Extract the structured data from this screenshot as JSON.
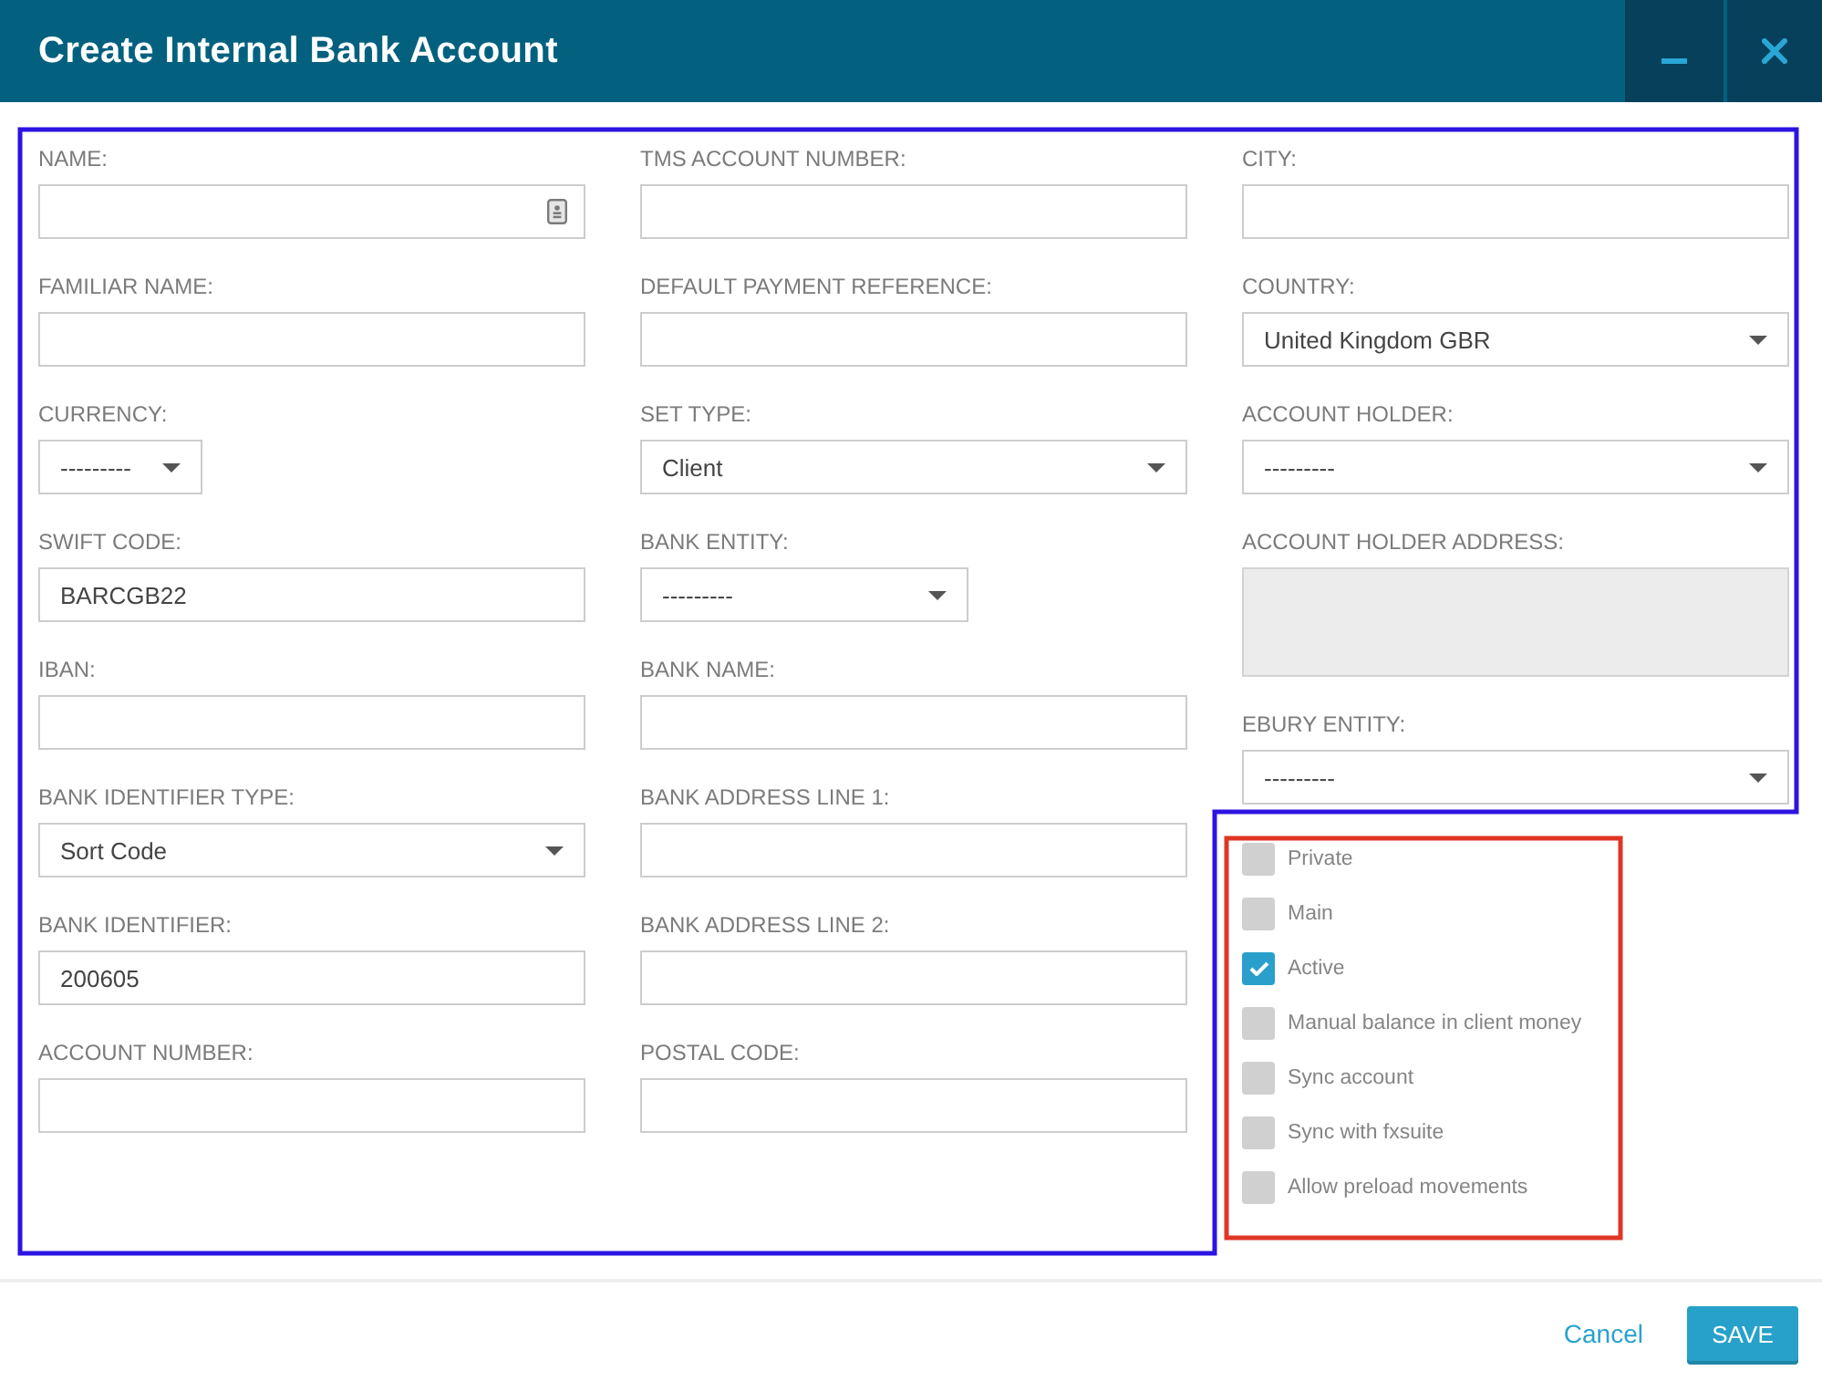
{
  "window": {
    "title": "Create Internal Bank Account"
  },
  "form": {
    "columns": [
      {
        "fields": [
          {
            "kind": "autofill",
            "label": "NAME:",
            "disabled": false
          },
          {
            "kind": "text",
            "label": "FAMILIAR NAME:",
            "disabled": false
          },
          {
            "kind": "shortselect",
            "label": "CURRENCY:",
            "value": "---------",
            "disabled": false
          },
          {
            "kind": "text",
            "label": "SWIFT CODE:",
            "value": "BARCGB22",
            "disabled": false
          },
          {
            "kind": "text",
            "label": "IBAN:",
            "disabled": false
          },
          {
            "kind": "select",
            "label": "BANK IDENTIFIER TYPE:",
            "value": "Sort Code",
            "disabled": false
          },
          {
            "kind": "text",
            "label": "BANK IDENTIFIER:",
            "value": "200605",
            "disabled": false
          },
          {
            "kind": "text",
            "label": "ACCOUNT NUMBER:",
            "disabled": false
          }
        ]
      },
      {
        "fields": [
          {
            "kind": "text",
            "label": "TMS ACCOUNT NUMBER:",
            "disabled": false
          },
          {
            "kind": "text",
            "label": "DEFAULT PAYMENT REFERENCE:",
            "disabled": false
          },
          {
            "kind": "select",
            "label": "SET TYPE:",
            "value": "Client",
            "disabled": false
          },
          {
            "kind": "midselect",
            "label": "BANK ENTITY:",
            "value": "---------",
            "disabled": false
          },
          {
            "kind": "text",
            "label": "BANK NAME:",
            "disabled": false
          },
          {
            "kind": "text",
            "label": "BANK ADDRESS LINE 1:",
            "disabled": false
          },
          {
            "kind": "text",
            "label": "BANK ADDRESS LINE 2:",
            "disabled": false
          },
          {
            "kind": "text",
            "label": "POSTAL CODE:",
            "disabled": false
          }
        ]
      },
      {
        "fields": [
          {
            "kind": "text",
            "label": "CITY:",
            "disabled": false
          },
          {
            "kind": "select",
            "label": "COUNTRY:",
            "value": "United Kingdom GBR",
            "disabled": false
          },
          {
            "kind": "select",
            "label": "ACCOUNT HOLDER:",
            "value": "---------",
            "disabled": false
          },
          {
            "kind": "textarea",
            "label": "ACCOUNT HOLDER ADDRESS:",
            "disabled": true
          },
          {
            "kind": "select",
            "label": "EBURY ENTITY:",
            "value": "---------",
            "disabled": false
          }
        ],
        "checkboxes": [
          {
            "label": "Private",
            "checked": false
          },
          {
            "label": "Main",
            "checked": false
          },
          {
            "label": "Active",
            "checked": true
          },
          {
            "label": "Manual balance in client money",
            "checked": false
          },
          {
            "label": "Sync account",
            "checked": false
          },
          {
            "label": "Sync with fxsuite",
            "checked": false
          },
          {
            "label": "Allow preload movements",
            "checked": false
          }
        ]
      }
    ]
  },
  "footer": {
    "buttons": [
      {
        "kind": "link",
        "label": "Cancel"
      },
      {
        "kind": "primary",
        "label": "SAVE"
      }
    ]
  }
}
